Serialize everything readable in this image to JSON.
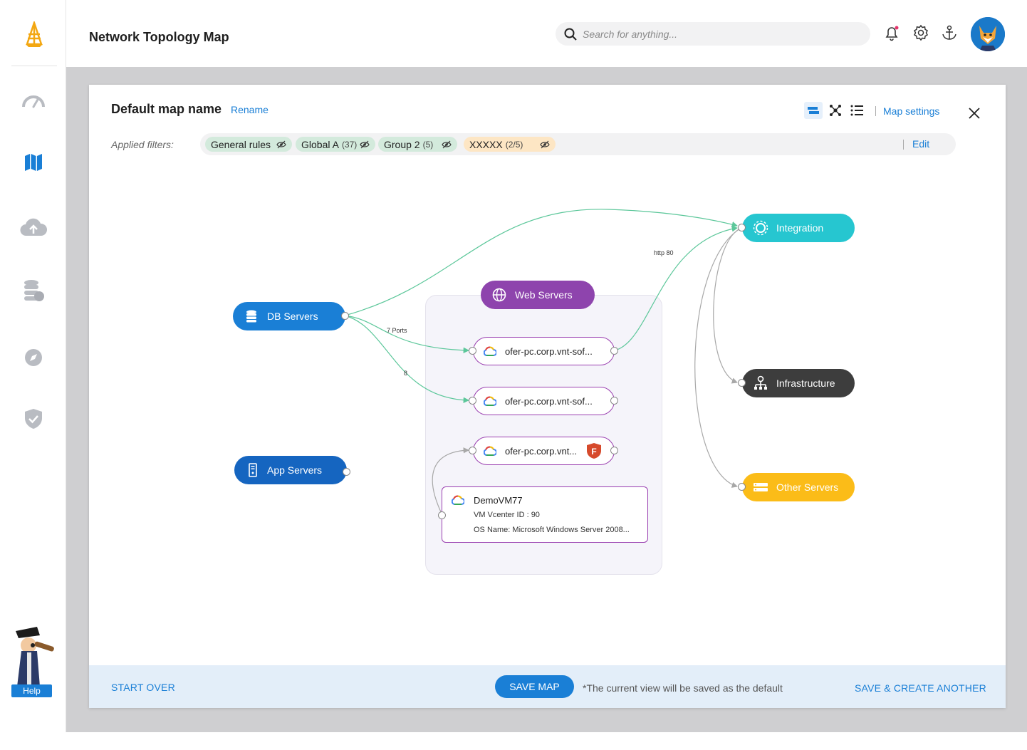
{
  "header": {
    "title": "Network Topology Map",
    "search_placeholder": "Search for anything..."
  },
  "sidebar": {
    "items": [
      {
        "icon": "speedometer-icon"
      },
      {
        "icon": "map-icon",
        "active": true
      },
      {
        "icon": "cloud-upload-icon"
      },
      {
        "icon": "database-icon"
      },
      {
        "icon": "compass-icon"
      },
      {
        "icon": "shield-check-icon"
      }
    ],
    "help_label": "Help"
  },
  "modal": {
    "map_name": "Default map name",
    "rename_label": "Rename",
    "map_settings_label": "Map settings",
    "filters_label": "Applied filters:",
    "edit_label": "Edit",
    "filters": [
      {
        "label": "General rules",
        "count": "",
        "color": "#d3eadc"
      },
      {
        "label": "Global A",
        "count": "(37)",
        "color": "#d3eadc"
      },
      {
        "label": "Group 2",
        "count": "(5)",
        "color": "#d3eadc"
      },
      {
        "label": "XXXXX",
        "count": "(2/5)",
        "color": "#fde6c4"
      }
    ]
  },
  "map": {
    "nodes": {
      "db_servers": {
        "label": "DB Servers",
        "color": "#1a7fd6"
      },
      "app_servers": {
        "label": "App Servers",
        "color": "#1565c0"
      },
      "web_servers": {
        "label": "Web Servers",
        "color": "#8e44ad"
      },
      "integration": {
        "label": "Integration",
        "color": "#26c6d0"
      },
      "infrastructure": {
        "label": "Infrastructure",
        "color": "#3d3d3d"
      },
      "other_servers": {
        "label": "Other Servers",
        "color": "#fbbc18"
      }
    },
    "vms": [
      {
        "label": "ofer-pc.corp.vnt-sof..."
      },
      {
        "label": "ofer-pc.corp.vnt-sof..."
      },
      {
        "label": "ofer-pc.corp.vnt...",
        "badge": "F"
      }
    ],
    "vm_card": {
      "title": "DemoVM77",
      "line1": "VM Vcenter ID : 90",
      "line2": "OS Name: Microsoft Windows Server 2008..."
    },
    "edge_labels": {
      "ports": "7 Ports",
      "eight": "8",
      "http": "http 80"
    }
  },
  "footer": {
    "start_over": "START OVER",
    "save_map": "SAVE MAP",
    "note": "*The current view will be saved as the default",
    "save_create": "SAVE & CREATE ANOTHER"
  }
}
